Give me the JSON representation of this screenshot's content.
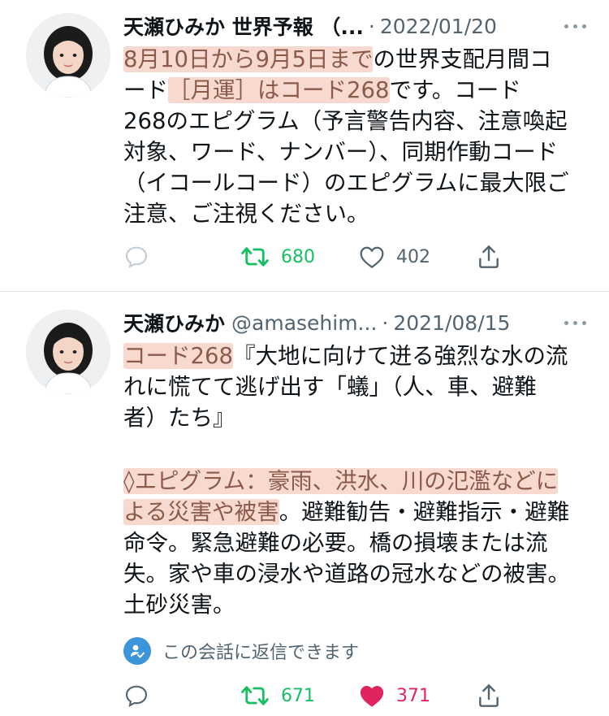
{
  "tweets": [
    {
      "author_name": "天瀬ひみか 世界予報 （...",
      "handle": "",
      "separator": "·",
      "date": "2022/01/20",
      "lines": [
        [
          {
            "t": "8月10日から9月5日まで",
            "h": true
          },
          {
            "t": "の世界支配月間コ",
            "h": false
          }
        ],
        [
          {
            "t": "ード",
            "h": false
          },
          {
            "t": "［月運］はコード268",
            "h": true
          },
          {
            "t": "です。コード",
            "h": false
          }
        ],
        [
          {
            "t": "268のエピグラム（予言警告内容、注意喚起",
            "h": false
          }
        ],
        [
          {
            "t": "対象、ワード、ナンバー）、同期作動コード",
            "h": false
          }
        ],
        [
          {
            "t": "（イコールコード）のエピグラムに最大限ご",
            "h": false
          }
        ],
        [
          {
            "t": "注意、ご注視ください。",
            "h": false
          }
        ]
      ],
      "reply_count": "",
      "retweet_count": "680",
      "like_count": "402",
      "liked": false
    },
    {
      "author_name": "天瀬ひみか",
      "handle": "@amasehim...",
      "separator": "·",
      "date": "2021/08/15",
      "lines": [
        [
          {
            "t": "コード268",
            "h": true
          },
          {
            "t": "『大地に向けて迸る強烈な水の流",
            "h": false
          }
        ],
        [
          {
            "t": "れに慌てて逃げ出す「蟻」（人、車、避難",
            "h": false
          }
        ],
        [
          {
            "t": "者）たち』",
            "h": false
          }
        ],
        [],
        [
          {
            "t": "◊エピグラム：豪雨、洪水、川の氾濫などに",
            "h": true
          }
        ],
        [
          {
            "t": "よる災害や被害",
            "h": true
          },
          {
            "t": "。避難勧告・避難指示・避難",
            "h": false
          }
        ],
        [
          {
            "t": "命令。緊急避難の必要。橋の損壊または流",
            "h": false
          }
        ],
        [
          {
            "t": "失。家や車の浸水や道路の冠水などの被害。",
            "h": false
          }
        ],
        [
          {
            "t": "土砂災害。",
            "h": false
          }
        ]
      ],
      "reply_notice": "この会話に返信できます",
      "reply_count": "",
      "retweet_count": "671",
      "like_count": "371",
      "liked": true
    }
  ],
  "icons": {
    "reply": "reply-icon",
    "retweet": "retweet-icon",
    "like": "heart-icon",
    "share": "share-icon",
    "more": "more-icon",
    "avatar": "avatar-image"
  },
  "colors": {
    "text": "#0f1419",
    "secondary": "#536471",
    "highlight_bg": "#f8d9cf",
    "highlight_text": "#8a5a4b",
    "retweet_green": "#17bf63",
    "like_pink": "#e0245e",
    "notice_badge": "#3b95d8"
  }
}
